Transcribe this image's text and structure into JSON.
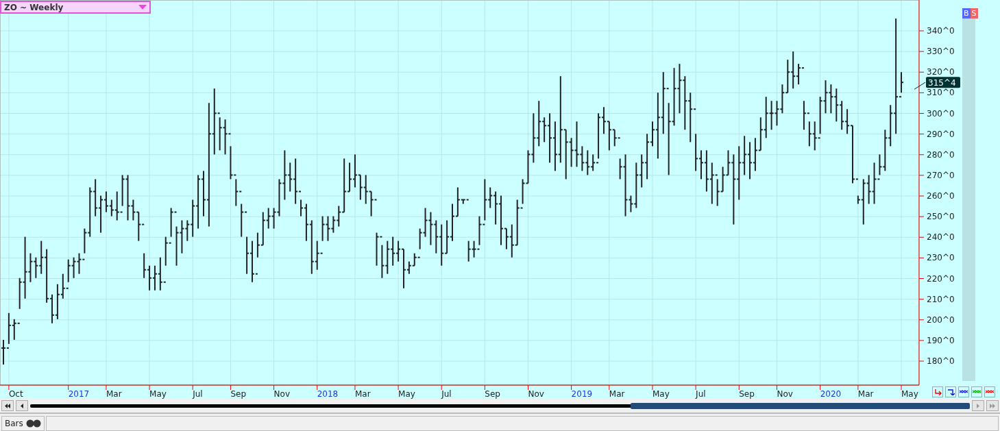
{
  "chart": {
    "title": "ZO ~ Weekly",
    "last_price": "315^4",
    "price_axis_labels": [
      "340^0",
      "330^0",
      "320^0",
      "310^0",
      "300^0",
      "290^0",
      "280^0",
      "270^0",
      "260^0",
      "250^0",
      "240^0",
      "230^0",
      "220^0",
      "210^0",
      "200^0",
      "190^0",
      "180^0"
    ],
    "time_axis_labels": [
      "Oct",
      "2017",
      "Mar",
      "May",
      "Jul",
      "Sep",
      "Nov",
      "2018",
      "Mar",
      "May",
      "Jul",
      "Sep",
      "Nov",
      "2019",
      "Mar",
      "May",
      "Jul",
      "Sep",
      "Nov",
      "2020",
      "Mar",
      "May"
    ]
  },
  "side_buttons": [
    "B",
    "S"
  ],
  "study_tab": {
    "label": "Bars"
  }
}
